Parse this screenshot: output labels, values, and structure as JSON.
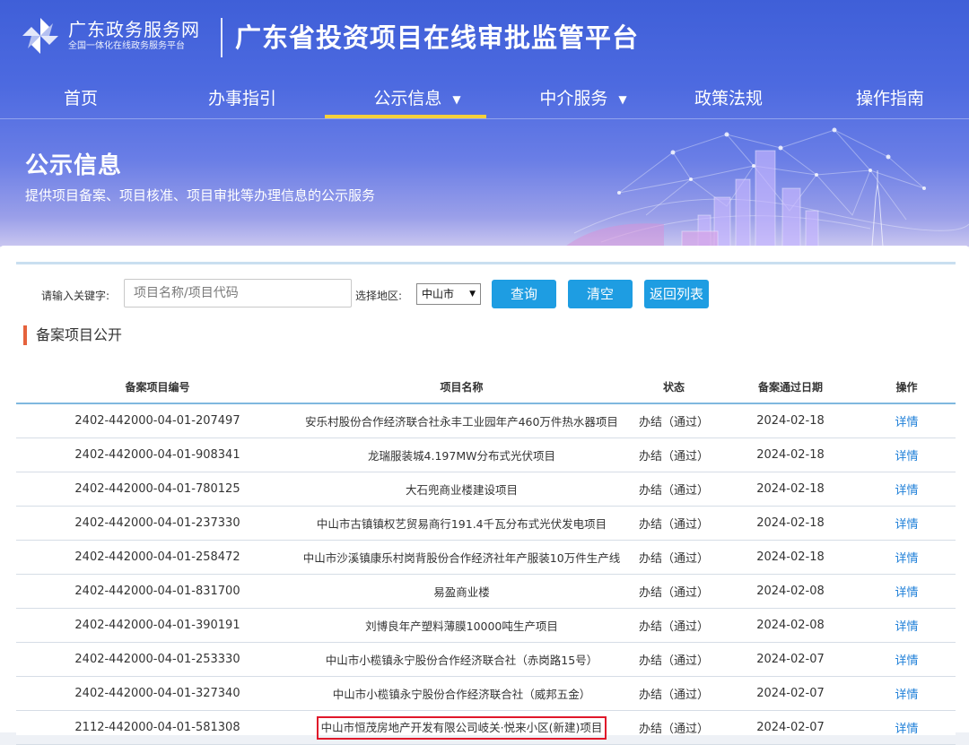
{
  "header": {
    "brand_name": "广东政务服务网",
    "brand_sub": "全国一体化在线政务服务平台",
    "platform_title": "广东省投资项目在线审批监管平台"
  },
  "nav": {
    "items": [
      {
        "label": "首页"
      },
      {
        "label": "办事指引"
      },
      {
        "label": "公示信息",
        "active": true,
        "has_dropdown": true
      },
      {
        "label": "中介服务",
        "has_dropdown": true
      },
      {
        "label": "政策法规"
      },
      {
        "label": "操作指南"
      }
    ],
    "active_color": "#f5d13a"
  },
  "hero": {
    "title": "公示信息",
    "subtitle": "提供项目备案、项目核准、项目审批等办理信息的公示服务"
  },
  "search": {
    "keyword_label": "请输入关键字:",
    "keyword_placeholder": "项目名称/项目代码",
    "area_label": "选择地区:",
    "area_value": "中山市",
    "query_button": "查询",
    "clear_button": "清空",
    "back_button": "返回列表"
  },
  "section": {
    "title": "备案项目公开"
  },
  "table": {
    "headers": [
      "备案项目编号",
      "项目名称",
      "状态",
      "备案通过日期",
      "操作"
    ],
    "rows": [
      {
        "code": "2402-442000-04-01-207497",
        "name": "安乐村股份合作经济联合社永丰工业园年产460万件热水器项目",
        "status": "办结（通过）",
        "date": "2024-02-18",
        "action": "详情"
      },
      {
        "code": "2402-442000-04-01-908341",
        "name": "龙瑞服装城4.197MW分布式光伏项目",
        "status": "办结（通过）",
        "date": "2024-02-18",
        "action": "详情"
      },
      {
        "code": "2402-442000-04-01-780125",
        "name": "大石兜商业楼建设项目",
        "status": "办结（通过）",
        "date": "2024-02-18",
        "action": "详情"
      },
      {
        "code": "2402-442000-04-01-237330",
        "name": "中山市古镇镇权艺贸易商行191.4千瓦分布式光伏发电项目",
        "status": "办结（通过）",
        "date": "2024-02-18",
        "action": "详情"
      },
      {
        "code": "2402-442000-04-01-258472",
        "name": "中山市沙溪镇康乐村岗背股份合作经济社年产服装10万件生产线",
        "status": "办结（通过）",
        "date": "2024-02-18",
        "action": "详情"
      },
      {
        "code": "2402-442000-04-01-831700",
        "name": "易盈商业楼",
        "status": "办结（通过）",
        "date": "2024-02-08",
        "action": "详情"
      },
      {
        "code": "2402-442000-04-01-390191",
        "name": "刘博良年产塑料薄膜10000吨生产项目",
        "status": "办结（通过）",
        "date": "2024-02-08",
        "action": "详情"
      },
      {
        "code": "2402-442000-04-01-253330",
        "name": "中山市小榄镇永宁股份合作经济联合社（赤岗路15号）",
        "status": "办结（通过）",
        "date": "2024-02-07",
        "action": "详情"
      },
      {
        "code": "2402-442000-04-01-327340",
        "name": "中山市小榄镇永宁股份合作经济联合社（威邦五金）",
        "status": "办结（通过）",
        "date": "2024-02-07",
        "action": "详情"
      },
      {
        "code": "2112-442000-04-01-581308",
        "name": "中山市恒茂房地产开发有限公司岐关·悦来小区(新建)项目",
        "status": "办结（通过）",
        "date": "2024-02-07",
        "action": "详情",
        "highlighted": true
      }
    ]
  },
  "colors": {
    "header_blue": "#3f5fd8",
    "button_blue": "#1e9de2",
    "link_blue": "#1e7fd8",
    "section_accent": "#e5623c",
    "highlight_red": "#e0182a"
  }
}
